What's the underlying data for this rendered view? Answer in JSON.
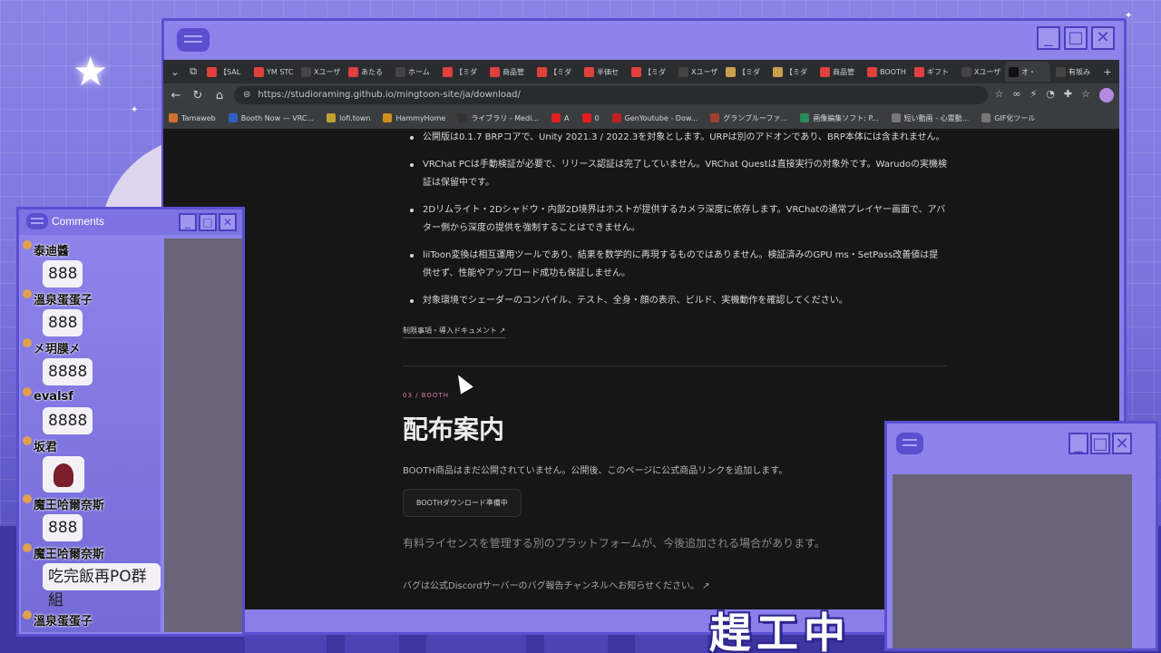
{
  "browser": {
    "tabs": [
      {
        "label": "【SAL",
        "color": "#e0413c"
      },
      {
        "label": "YM STC",
        "color": "#e0413c"
      },
      {
        "label": "Xユーザ",
        "color": "#444444"
      },
      {
        "label": "あたる",
        "color": "#e0413c"
      },
      {
        "label": "ホーム",
        "color": "#444444"
      },
      {
        "label": "【ミダ",
        "color": "#e0413c"
      },
      {
        "label": "商品管",
        "color": "#e0413c"
      },
      {
        "label": "【ミダ",
        "color": "#e0413c"
      },
      {
        "label": "半価セ",
        "color": "#e0413c"
      },
      {
        "label": "【ミダ",
        "color": "#e0413c"
      },
      {
        "label": "Xユーザ",
        "color": "#444444"
      },
      {
        "label": "【ミダ",
        "color": "#c9a050"
      },
      {
        "label": "【ミダ",
        "color": "#c9a050"
      },
      {
        "label": "商品管",
        "color": "#e0413c"
      },
      {
        "label": "BOOTH",
        "color": "#e0413c"
      },
      {
        "label": "ギフト",
        "color": "#e0413c"
      },
      {
        "label": "Xユーザ",
        "color": "#444444"
      },
      {
        "label": "オ・",
        "color": "#111111"
      },
      {
        "label": "有坂み",
        "color": "#444444"
      }
    ],
    "url": "https://studioraming.github.io/mingtoon-site/ja/download/",
    "bookmarks": [
      "Tamaweb",
      "Booth Now — VRC...",
      "lofi.town",
      "HammyHome",
      "ライブラリ - Medi...",
      "A",
      "0",
      "GenYoutube - Dow...",
      "グランブルーファ...",
      "画像編集ソフト: P...",
      "短い動画 - 心霊動...",
      "GIF化ツール"
    ]
  },
  "page": {
    "bullets": [
      "公開版は0.1.7 BRPコアで、Unity 2021.3 / 2022.3を対象とします。URPは別のアドオンであり、BRP本体には含まれません。",
      "VRChat PCは手動検証が必要で、リリース認証は完了していません。VRChat Questは直接実行の対象外です。Warudoの実機検証は保留中です。",
      "2Dリムライト・2Dシャドウ・内部2D境界はホストが提供するカメラ深度に依存します。VRChatの通常プレイヤー画面で、アバター側から深度の提供を強制することはできません。",
      "liiToon変換は相互運用ツールであり、結果を数学的に再現するものではありません。検証済みのGPU ms・SetPass改善値は提供せず、性能やアップロード成功も保証しません。",
      "対象環境でシェーダーのコンパイル、テスト、全身・顔の表示、ビルド、実機動作を確認してください。"
    ],
    "limits_link": "制限事項・導入ドキュメント ↗",
    "kicker": "03 / BOOTH",
    "heading": "配布案内",
    "desc": "BOOTH商品はまだ公開されていません。公開後、このページに公式商品リンクを追加します。",
    "button": "BOOTHダウンロード準備中",
    "note": "有料ライセンスを管理する別のプラットフォームが、今後追加される場合があります。",
    "discord": "バグは公式Discordサーバーのバグ報告チャンネルへお知らせください。 ↗"
  },
  "comments": {
    "title": "Comments",
    "items": [
      {
        "user": "泰迪醬",
        "msg": "888"
      },
      {
        "user": "溫泉蛋蛋子",
        "msg": "888"
      },
      {
        "user": "㐅玥膜㐅",
        "msg": "8888"
      },
      {
        "user": "evalsf",
        "msg": "8888"
      },
      {
        "user": "坂君",
        "msg": ""
      },
      {
        "user": "魔王哈爾奈斯",
        "msg": "888"
      },
      {
        "user": "魔王哈爾奈斯",
        "msg": "吃完飯再PO群組"
      },
      {
        "user": "溫泉蛋蛋子",
        "msg": ""
      }
    ]
  },
  "banner": "趕工中"
}
